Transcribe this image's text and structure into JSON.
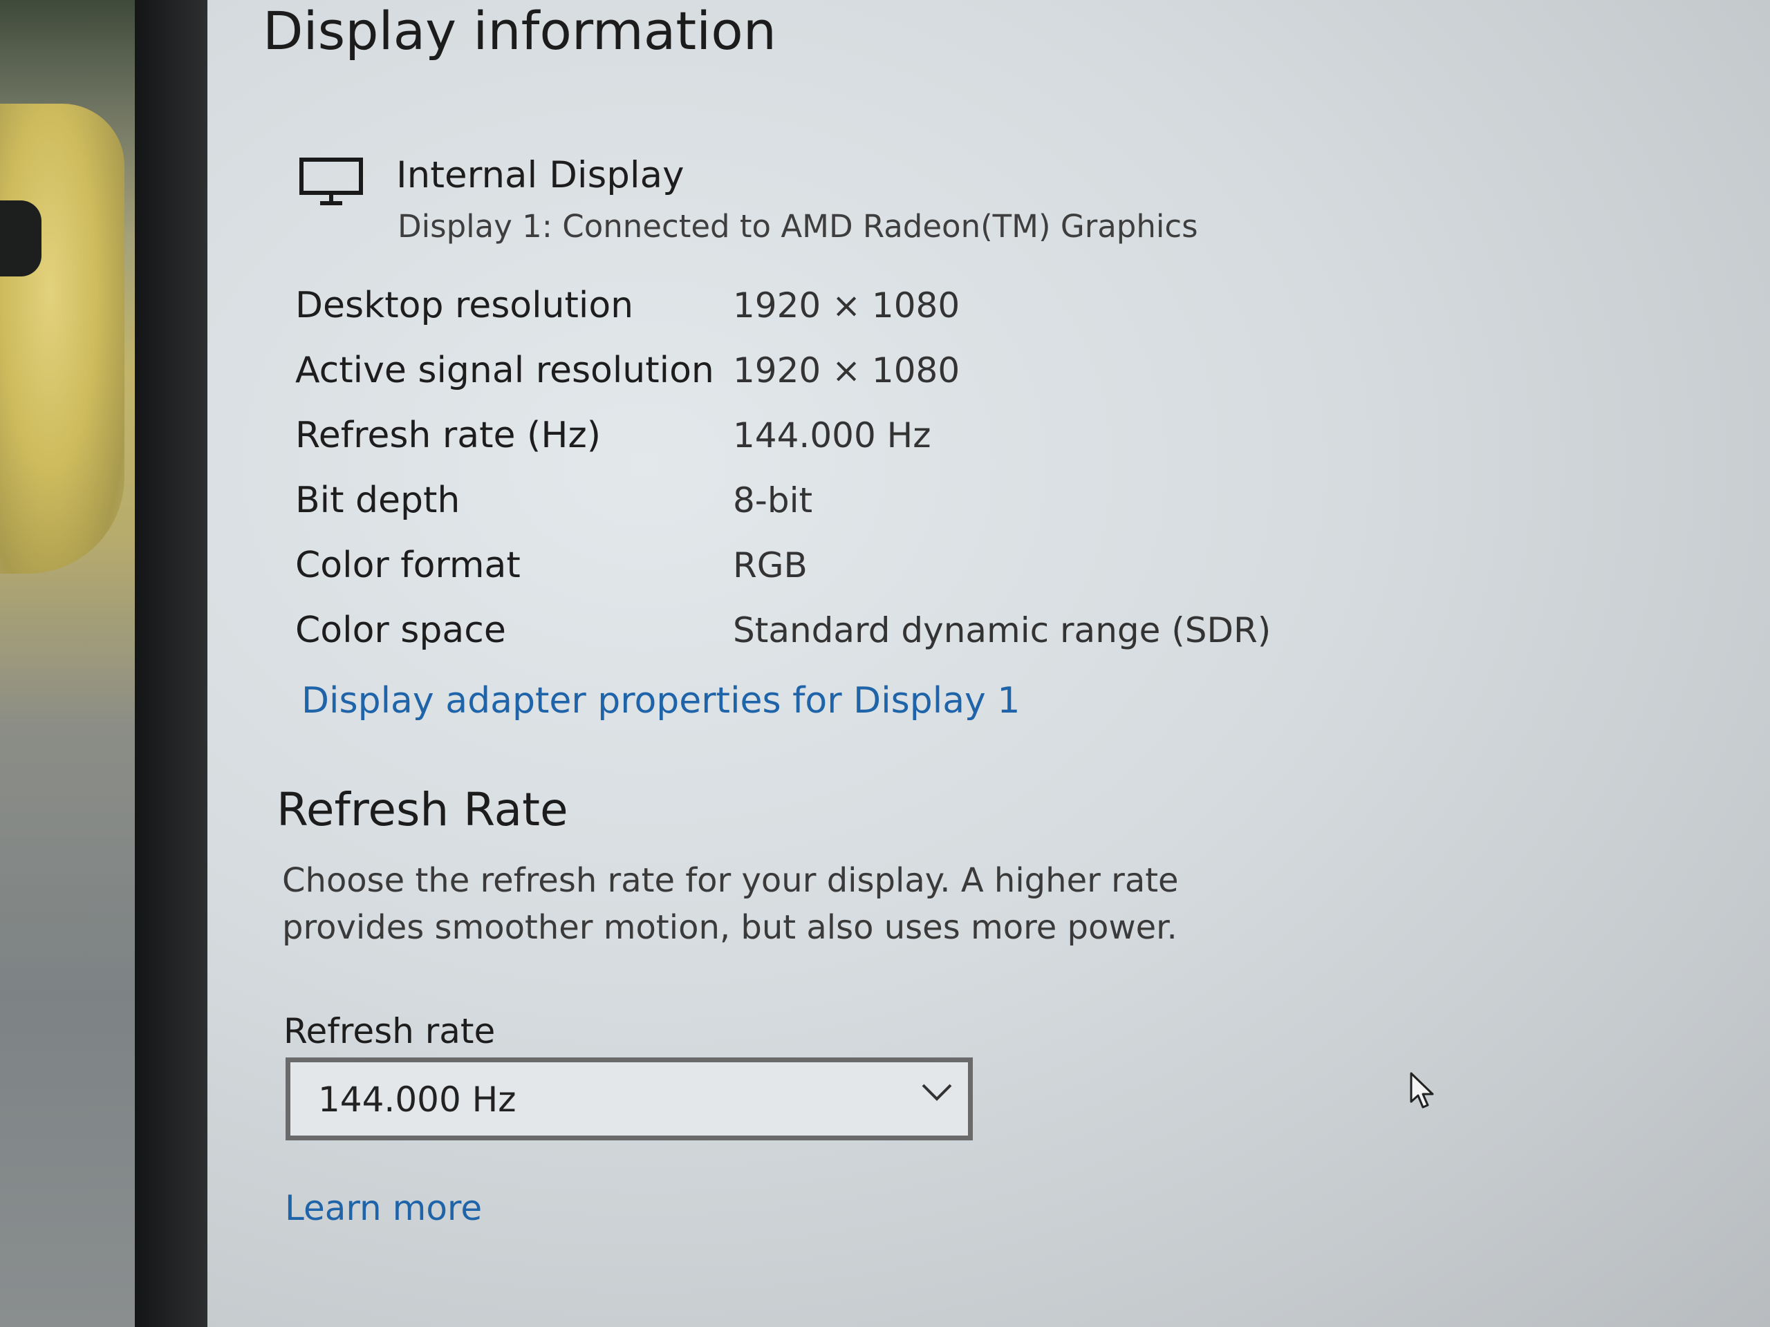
{
  "display_info": {
    "title": "Display information",
    "display_name": "Internal Display",
    "display_subtitle": "Display 1: Connected to AMD Radeon(TM) Graphics",
    "rows": [
      {
        "label": "Desktop resolution",
        "value": "1920 × 1080"
      },
      {
        "label": "Active signal resolution",
        "value": "1920 × 1080"
      },
      {
        "label": "Refresh rate (Hz)",
        "value": "144.000 Hz"
      },
      {
        "label": "Bit depth",
        "value": "8-bit"
      },
      {
        "label": "Color format",
        "value": "RGB"
      },
      {
        "label": "Color space",
        "value": "Standard dynamic range (SDR)"
      }
    ],
    "adapter_link": "Display adapter properties for Display 1"
  },
  "refresh_rate": {
    "title": "Refresh Rate",
    "description": "Choose the refresh rate for your display. A higher rate provides smoother motion, but also uses more power.",
    "field_label": "Refresh rate",
    "selected_value": "144.000 Hz",
    "learn_more": "Learn more"
  },
  "icons": {
    "display": "monitor-icon",
    "dropdown": "chevron-down-icon",
    "pointer": "mouse-cursor-icon"
  },
  "colors": {
    "link": "#1f63a8",
    "text": "#1d1d1d"
  }
}
